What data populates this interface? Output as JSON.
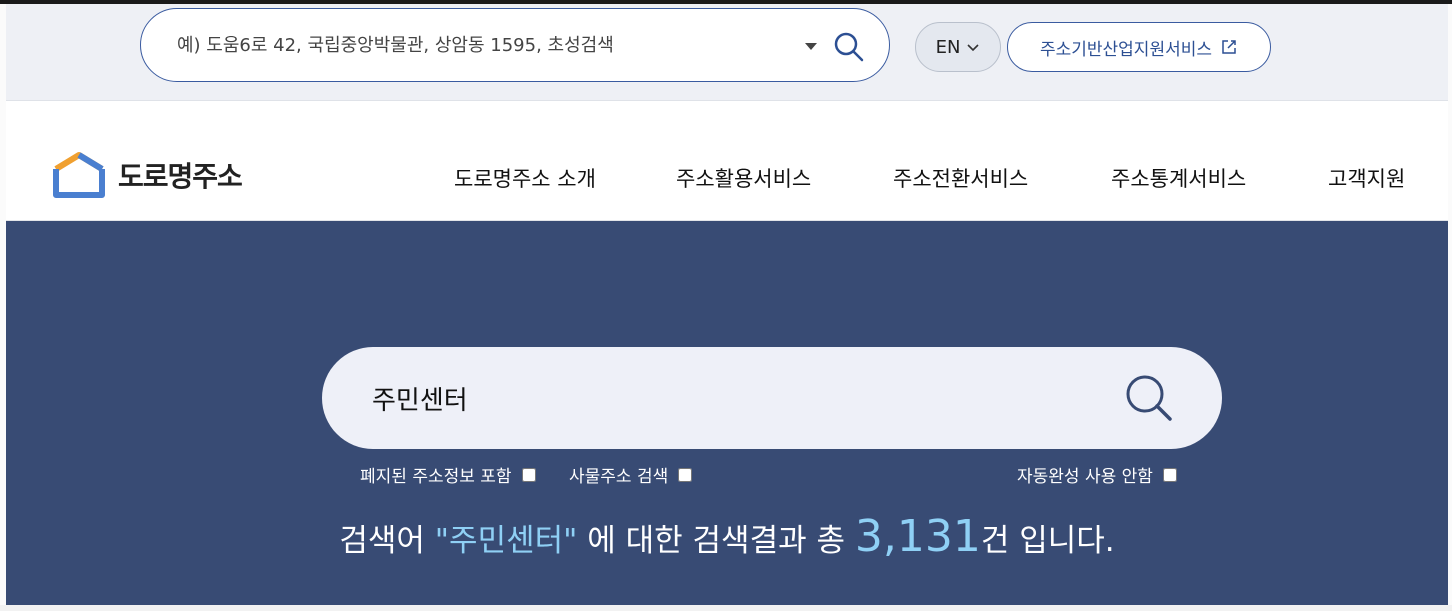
{
  "top_bar": {
    "search_placeholder": "예) 도움6로 42, 국립중앙박물관, 상암동 1595, 초성검색",
    "language_label": "EN",
    "external_service_label": "주소기반산업지원서비스"
  },
  "header": {
    "logo_text": "도로명주소",
    "nav": [
      {
        "label": "도로명주소 소개"
      },
      {
        "label": "주소활용서비스"
      },
      {
        "label": "주소전환서비스"
      },
      {
        "label": "주소통계서비스"
      },
      {
        "label": "고객지원"
      }
    ]
  },
  "main": {
    "search_value": "주민센터",
    "options": {
      "include_abolished_label": "폐지된 주소정보 포함",
      "object_address_label": "사물주소 검색",
      "disable_autocomplete_label": "자동완성 사용 안함"
    },
    "result": {
      "prefix": "검색어",
      "keyword": "\"주민센터\"",
      "middle": "에 대한 검색결과 총",
      "count": "3,131",
      "suffix": "건 입니다."
    }
  },
  "colors": {
    "banner": "#384b74",
    "accent": "#3a5ba0",
    "highlight": "#8fd0f5",
    "logo_orange": "#f0a030",
    "logo_blue": "#4a7fd0"
  }
}
